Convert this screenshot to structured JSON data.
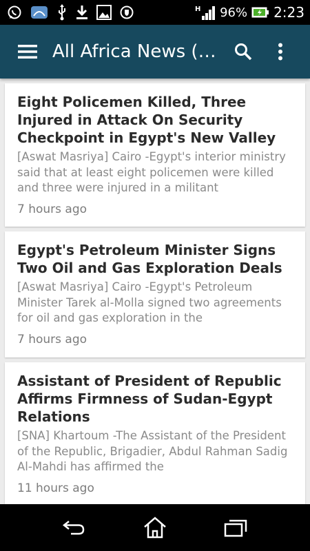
{
  "status_bar": {
    "battery_percent": "96%",
    "time": "2:23",
    "network": "H",
    "icons": [
      "whatsapp-icon",
      "app-icon",
      "usb-icon",
      "download-icon",
      "image-icon",
      "shield-icon",
      "signal-icon",
      "battery-icon"
    ]
  },
  "app_bar": {
    "title": "All Africa News (…",
    "background": "#17495e"
  },
  "articles": [
    {
      "title": "Eight Policemen Killed, Three Injured in Attack On Security Checkpoint in Egypt's New Valley",
      "summary": "[Aswat Masriya] Cairo -Egypt's interior ministry said that at least eight policemen were killed and three were injured in a militant",
      "time": "7 hours ago"
    },
    {
      "title": "Egypt's Petroleum Minister Signs Two Oil and Gas Exploration Deals",
      "summary": "[Aswat Masriya] Cairo -Egypt's Petroleum Minister Tarek al-Molla signed two agreements for oil and gas exploration in the",
      "time": "7 hours ago"
    },
    {
      "title": "Assistant of President of Republic Affirms Firmness of Sudan-Egypt Relations",
      "summary": "[SNA] Khartoum -The Assistant of the President of the Republic, Brigadier, Abdul Rahman Sadig Al-Mahdi has affirmed the",
      "time": "11 hours ago"
    }
  ]
}
